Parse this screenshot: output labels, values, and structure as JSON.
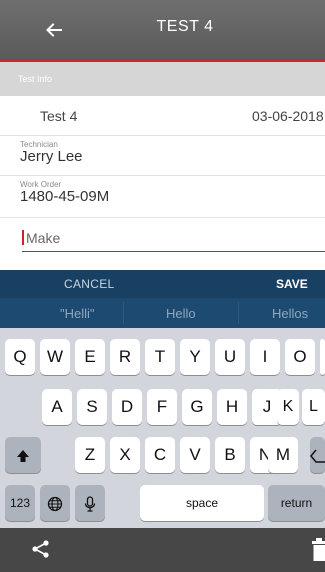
{
  "header": {
    "title": "TEST 4",
    "back_icon": "arrow-left-icon"
  },
  "section": {
    "label": "Test Info"
  },
  "test_row": {
    "name": "Test 4",
    "date": "03-06-2018"
  },
  "technician": {
    "label": "Technician",
    "value": "Jerry Lee"
  },
  "work_order": {
    "label": "Work Order",
    "value": "1480-45-09M"
  },
  "make": {
    "placeholder": "Make",
    "value": ""
  },
  "actions": {
    "cancel": "CANCEL",
    "save": "SAVE"
  },
  "suggestions": [
    "\"Helli\"",
    "Hello",
    "Hellos"
  ],
  "keyboard": {
    "row1": [
      "Q",
      "W",
      "E",
      "R",
      "T",
      "Y",
      "U",
      "I",
      "O",
      "P"
    ],
    "row2": [
      "A",
      "S",
      "D",
      "F",
      "G",
      "H",
      "J",
      "K",
      "L"
    ],
    "row3": [
      "Z",
      "X",
      "C",
      "V",
      "B",
      "N",
      "M"
    ],
    "shift_icon": "shift-arrow-icon",
    "backspace_icon": "backspace-icon",
    "numbers": "123",
    "globe_icon": "globe-icon",
    "mic_icon": "microphone-icon",
    "space": "space",
    "return": "return"
  },
  "bottom_nav": {
    "share_icon": "share-icon",
    "trash_icon": "trash-icon"
  },
  "colors": {
    "header": "#5f5f5f",
    "accent_red": "#c62828",
    "action_bar": "#174063",
    "suggestion_bar": "#1d4a70",
    "keyboard_bg": "#d2d5db",
    "bottom_nav": "#474747"
  }
}
